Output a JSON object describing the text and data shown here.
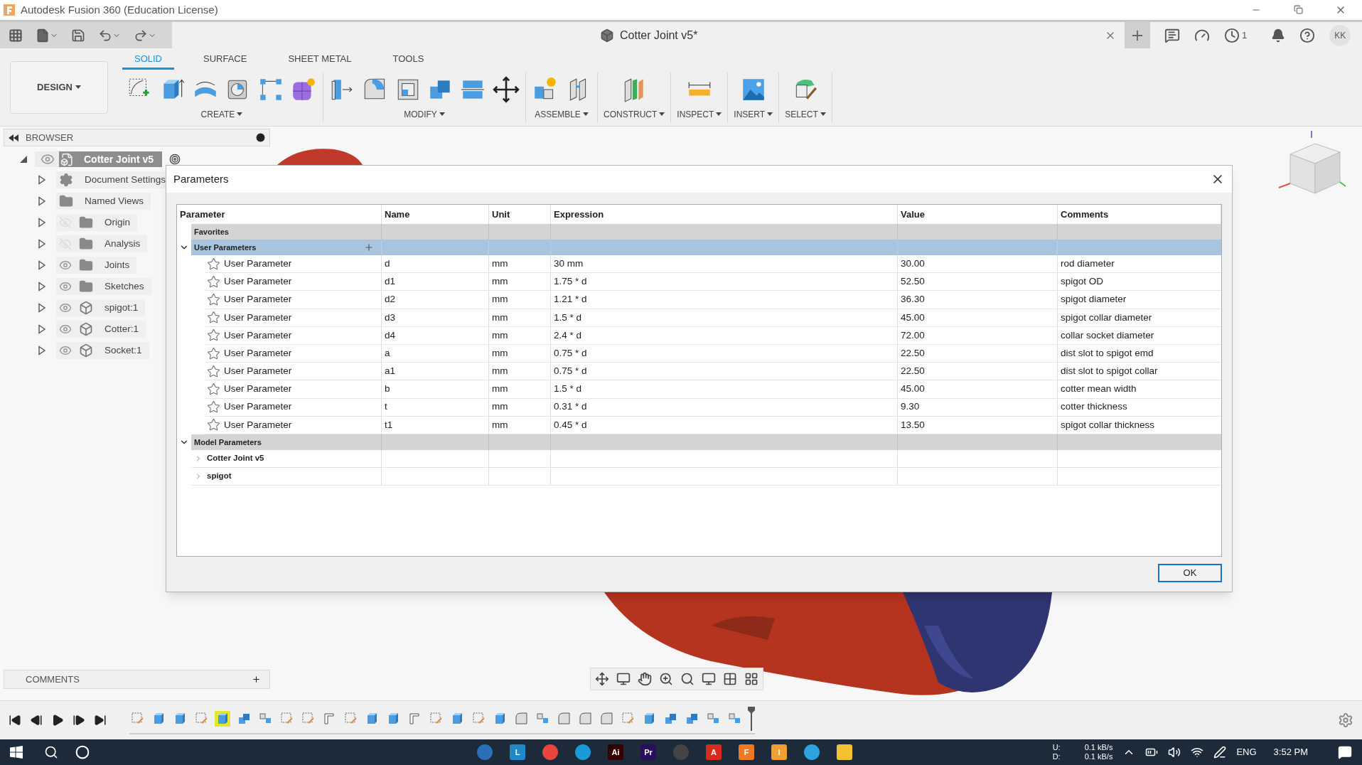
{
  "app_title": "Autodesk Fusion 360 (Education License)",
  "document_tab": {
    "title": "Cotter Joint v5*"
  },
  "job_count": "1",
  "user_initials": "KK",
  "workspace": "DESIGN",
  "toolbar_tabs": [
    {
      "label": "SOLID",
      "selected": true
    },
    {
      "label": "SURFACE",
      "selected": false
    },
    {
      "label": "SHEET METAL",
      "selected": false
    },
    {
      "label": "TOOLS",
      "selected": false
    }
  ],
  "toolbar_groups": [
    {
      "label": "CREATE"
    },
    {
      "label": "MODIFY"
    },
    {
      "label": "ASSEMBLE"
    },
    {
      "label": "CONSTRUCT"
    },
    {
      "label": "INSPECT"
    },
    {
      "label": "INSERT"
    },
    {
      "label": "SELECT"
    }
  ],
  "browser": {
    "title": "BROWSER",
    "root": {
      "label": "Cotter Joint v5",
      "expanded": true,
      "visible": true
    },
    "items": [
      {
        "label": "Document Settings",
        "kind": "settings"
      },
      {
        "label": "Named Views",
        "kind": "views"
      },
      {
        "label": "Origin",
        "kind": "folder",
        "visible": false
      },
      {
        "label": "Analysis",
        "kind": "folder",
        "visible": false
      },
      {
        "label": "Joints",
        "kind": "folder",
        "visible": true
      },
      {
        "label": "Sketches",
        "kind": "folder",
        "visible": true
      },
      {
        "label": "spigot:1",
        "kind": "component",
        "visible": true
      },
      {
        "label": "Cotter:1",
        "kind": "component",
        "visible": true
      },
      {
        "label": "Socket:1",
        "kind": "component",
        "visible": true
      }
    ]
  },
  "dialog": {
    "title": "Parameters",
    "columns": [
      "Parameter",
      "Name",
      "Unit",
      "Expression",
      "Value",
      "Comments"
    ],
    "favorites": {
      "label": "Favorites"
    },
    "user_parameters": {
      "label": "User Parameters",
      "expanded": true,
      "rows": [
        {
          "parameter": "User Parameter",
          "favorite": false,
          "name": "d",
          "unit": "mm",
          "expression": "30 mm",
          "value": "30.00",
          "comment": "rod diameter"
        },
        {
          "parameter": "User Parameter",
          "favorite": false,
          "name": "d1",
          "unit": "mm",
          "expression": "1.75 * d",
          "value": "52.50",
          "comment": "spigot OD"
        },
        {
          "parameter": "User Parameter",
          "favorite": false,
          "name": "d2",
          "unit": "mm",
          "expression": "1.21 * d",
          "value": "36.30",
          "comment": "spigot diameter"
        },
        {
          "parameter": "User Parameter",
          "favorite": false,
          "name": "d3",
          "unit": "mm",
          "expression": "1.5 * d",
          "value": "45.00",
          "comment": "spigot collar diameter"
        },
        {
          "parameter": "User Parameter",
          "favorite": false,
          "name": "d4",
          "unit": "mm",
          "expression": "2.4 * d",
          "value": "72.00",
          "comment": "collar socket diameter"
        },
        {
          "parameter": "User Parameter",
          "favorite": false,
          "name": "a",
          "unit": "mm",
          "expression": "0.75 * d",
          "value": "22.50",
          "comment": "dist slot to spigot emd"
        },
        {
          "parameter": "User Parameter",
          "favorite": false,
          "name": "a1",
          "unit": "mm",
          "expression": "0.75 * d",
          "value": "22.50",
          "comment": "dist slot to spigot collar"
        },
        {
          "parameter": "User Parameter",
          "favorite": false,
          "name": "b",
          "unit": "mm",
          "expression": "1.5 * d",
          "value": "45.00",
          "comment": "cotter mean width"
        },
        {
          "parameter": "User Parameter",
          "favorite": false,
          "name": "t",
          "unit": "mm",
          "expression": "0.31 * d",
          "value": "9.30",
          "comment": "cotter thickness"
        },
        {
          "parameter": "User Parameter",
          "favorite": false,
          "name": "t1",
          "unit": "mm",
          "expression": "0.45 * d",
          "value": "13.50",
          "comment": "spigot collar thickness"
        }
      ]
    },
    "model_parameters": {
      "label": "Model Parameters",
      "expanded": true,
      "children": [
        {
          "label": "Cotter Joint v5",
          "expanded": false
        },
        {
          "label": "spigot",
          "expanded": false
        }
      ]
    },
    "ok_button": "OK"
  },
  "comments_panel": {
    "title": "COMMENTS"
  },
  "timeline": [
    {
      "kind": "sketch",
      "selected": false
    },
    {
      "kind": "extrude",
      "selected": false
    },
    {
      "kind": "extrude",
      "selected": false
    },
    {
      "kind": "sketch",
      "selected": false
    },
    {
      "kind": "extrude",
      "selected": true
    },
    {
      "kind": "combine",
      "selected": false
    },
    {
      "kind": "joint",
      "selected": false
    },
    {
      "kind": "sketch",
      "selected": false
    },
    {
      "kind": "sketch",
      "selected": false
    },
    {
      "kind": "plane",
      "selected": false
    },
    {
      "kind": "sketch",
      "selected": false
    },
    {
      "kind": "extrude",
      "selected": false
    },
    {
      "kind": "extrude",
      "selected": false
    },
    {
      "kind": "plane",
      "selected": false
    },
    {
      "kind": "sketch",
      "selected": false
    },
    {
      "kind": "extrude",
      "selected": false
    },
    {
      "kind": "sketch",
      "selected": false
    },
    {
      "kind": "extrude",
      "selected": false
    },
    {
      "kind": "fillet",
      "selected": false
    },
    {
      "kind": "joint",
      "selected": false
    },
    {
      "kind": "fillet",
      "selected": false
    },
    {
      "kind": "fillet",
      "selected": false
    },
    {
      "kind": "fillet",
      "selected": false
    },
    {
      "kind": "sketch",
      "selected": false
    },
    {
      "kind": "extrude",
      "selected": false
    },
    {
      "kind": "combine",
      "selected": false
    },
    {
      "kind": "combine",
      "selected": false
    },
    {
      "kind": "joint",
      "selected": false
    },
    {
      "kind": "joint",
      "selected": false
    }
  ],
  "taskbar": {
    "apps": [
      {
        "kind": "round",
        "color": "#2a6fb8"
      },
      {
        "kind": "tile",
        "label": "L",
        "color": "#1e88c8"
      },
      {
        "kind": "round",
        "color": "#e8453c"
      },
      {
        "kind": "round",
        "color": "#1a9bd7"
      },
      {
        "kind": "tile",
        "label": "Ai",
        "color": "#330000"
      },
      {
        "kind": "tile",
        "label": "Pr",
        "color": "#2a0f5c"
      },
      {
        "kind": "round",
        "color": "#444444"
      },
      {
        "kind": "tile",
        "label": "A",
        "color": "#d52b1e"
      },
      {
        "kind": "tile",
        "label": "F",
        "color": "#f07820"
      },
      {
        "kind": "tile",
        "label": "I",
        "color": "#f0a030"
      },
      {
        "kind": "round",
        "color": "#2aa3df"
      },
      {
        "kind": "tile",
        "color": "#f2c230"
      }
    ],
    "upload_label": "U:",
    "download_label": "D:",
    "upload_rate": "0.1 kB/s",
    "download_rate": "0.1 kB/s",
    "language": "ENG",
    "time": "3:52 PM"
  }
}
